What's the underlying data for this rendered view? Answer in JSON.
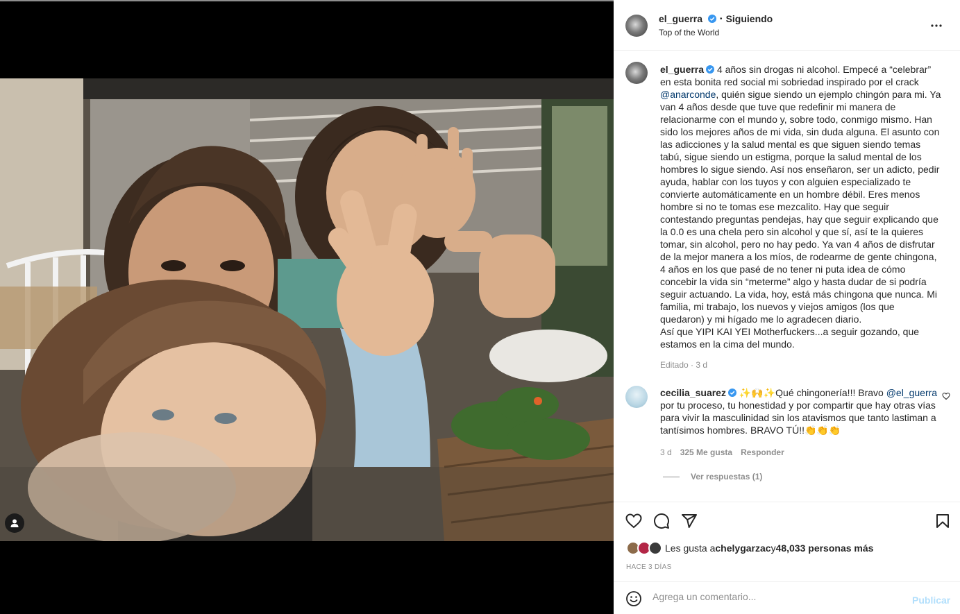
{
  "post": {
    "author": "el_guerra",
    "follow_state": "Siguiendo",
    "separator": "•",
    "location": "Top of the World",
    "more_label": "•••",
    "caption_user": "el_guerra",
    "caption_p1": "4 años sin drogas ni alcohol. Empecé a “celebrar” en esta bonita red social mi sobriedad inspirado por el crack ",
    "caption_mention": "@anarconde",
    "caption_p2": ", quién sigue siendo un ejemplo chingón para mi. Ya van 4 años desde que tuve que redefinir mi manera de relacionarme con el mundo y, sobre todo, conmigo mismo. Han sido los mejores años de mi vida, sin duda alguna. El asunto con las adicciones y la salud mental es que siguen siendo temas tabú, sigue siendo un estigma, porque la salud mental de los hombres lo sigue siendo. Así nos enseñaron, ser un adicto, pedir ayuda, hablar con los tuyos y con alguien especializado te convierte automáticamente en un hombre débil. Eres menos hombre si no te tomas ese mezcalito. Hay que seguir contestando preguntas pendejas, hay que seguir explicando que la 0.0 es una chela pero sin alcohol y que sí, así te la quieres tomar, sin alcohol, pero no hay pedo. Ya van 4 años de disfrutar de la mejor manera a los míos, de rodearme de gente chingona, 4 años en los que pasé de no tener ni puta idea de cómo concebir la vida sin “meterme” algo y hasta dudar de si podría seguir actuando. La vida, hoy, está más chingona que nunca. Mi familia, mi trabajo, los nuevos y viejos amigos (los que quedaron) y mi hígado me lo agradecen diario.",
    "caption_p3": "Así que YIPI KAI YEI Motherfuckers...a seguir gozando, que estamos en la cima del mundo.",
    "edited": "Editado · 3 d"
  },
  "comment": {
    "user": "cecilia_suarez",
    "emojis": "✨🙌✨",
    "text_p1": "Qué chingonería!!! Bravo ",
    "mention": "@el_guerra",
    "text_p2": " por tu proceso, tu honestidad y por compartir que hay otras vías para vivir la masculinidad sin los atavismos que tanto lastiman a tantísimos hombres. BRAVO TÚ!!",
    "claps": "👏👏👏",
    "time": "3 d",
    "likes": "325 Me gusta",
    "reply": "Responder",
    "view_replies": "Ver respuestas (1)"
  },
  "likes": {
    "prefix": "Les gusta a ",
    "user": "chelygarzac",
    "middle": " y ",
    "count": "48,033 personas más"
  },
  "timestamp": "HACE 3 DÍAS",
  "composer": {
    "placeholder": "Agrega un comentario...",
    "publish": "Publicar"
  },
  "icons": [
    "verified-icon",
    "more-icon",
    "heart-icon",
    "comment-icon",
    "share-icon",
    "save-icon",
    "emoji-icon",
    "user-tag-icon"
  ],
  "colors": {
    "link": "#00376b",
    "verified": "#3897f0",
    "publish_disabled": "#b2dffc",
    "muted": "#8e8e8e"
  }
}
